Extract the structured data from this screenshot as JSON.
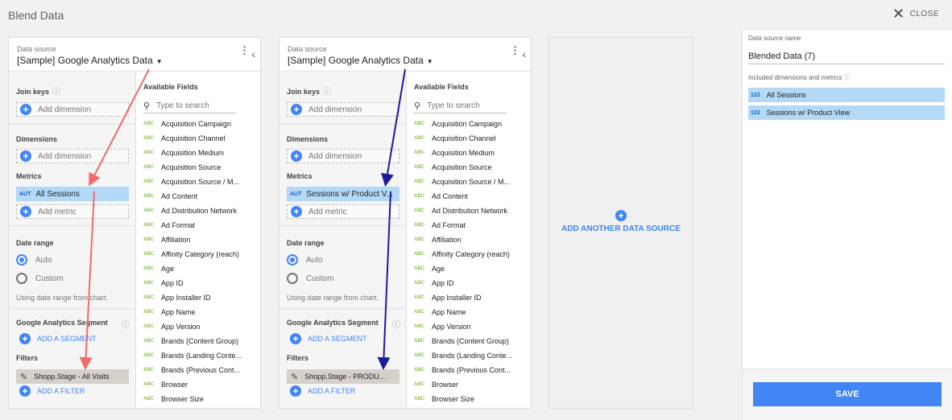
{
  "app": {
    "title": "Blend Data",
    "close_label": "CLOSE"
  },
  "panels": [
    {
      "ds_label": "Data source",
      "ds_value": "[Sample] Google Analytics Data",
      "join_keys": "Join keys",
      "add_dimension_join": "Add dimension",
      "dimensions": "Dimensions",
      "add_dimension": "Add dimension",
      "metrics": "Metrics",
      "metric_chip": "All Sessions",
      "metric_type": "AUT",
      "add_metric": "Add metric",
      "date_range": "Date range",
      "auto": "Auto",
      "custom": "Custom",
      "note": "Using date range from chart.",
      "segment": "Google Analytics Segment",
      "add_segment": "ADD A SEGMENT",
      "filters": "Filters",
      "filter_chip": "Shopp.Stage - All Visits",
      "add_filter": "ADD A FILTER"
    },
    {
      "ds_label": "Data source",
      "ds_value": "[Sample] Google Analytics Data",
      "join_keys": "Join keys",
      "add_dimension_join": "Add dimension",
      "dimensions": "Dimensions",
      "add_dimension": "Add dimension",
      "metrics": "Metrics",
      "metric_chip": "Sessions w/ Product V...",
      "metric_type": "AUT",
      "add_metric": "Add metric",
      "date_range": "Date range",
      "auto": "Auto",
      "custom": "Custom",
      "note": "Using date range from chart.",
      "segment": "Google Analytics Segment",
      "add_segment": "ADD A SEGMENT",
      "filters": "Filters",
      "filter_chip": "Shopp.Stage - PRODU...",
      "add_filter": "ADD A FILTER"
    }
  ],
  "available_fields": {
    "title": "Available Fields",
    "search_placeholder": "Type to search",
    "type_tag": "ABC",
    "items": [
      "Acquisition Campaign",
      "Acquisition Channel",
      "Acquisition Medium",
      "Acquisition Source",
      "Acquisition Source / M...",
      "Ad Content",
      "Ad Distribution Network",
      "Ad Format",
      "Affiliation",
      "Affinity Category (reach)",
      "Age",
      "App ID",
      "App Installer ID",
      "App Name",
      "App Version",
      "Brands (Content Group)",
      "Brands (Landing Conte...",
      "Brands (Previous Cont...",
      "Browser",
      "Browser Size"
    ]
  },
  "add_source": {
    "label": "ADD ANOTHER DATA SOURCE"
  },
  "side": {
    "name_label": "Data source name",
    "name_value": "Blended Data (7)",
    "included_label": "Included dimensions and metrics",
    "included": [
      {
        "type": "123",
        "label": "All Sessions"
      },
      {
        "type": "123",
        "label": "Sessions w/ Product View"
      }
    ],
    "save_label": "SAVE"
  },
  "colors": {
    "accent": "#4285f4",
    "arrow_red": "#f26b6b",
    "arrow_blue": "#1a1a9e",
    "chip": "#b3d9f7"
  }
}
